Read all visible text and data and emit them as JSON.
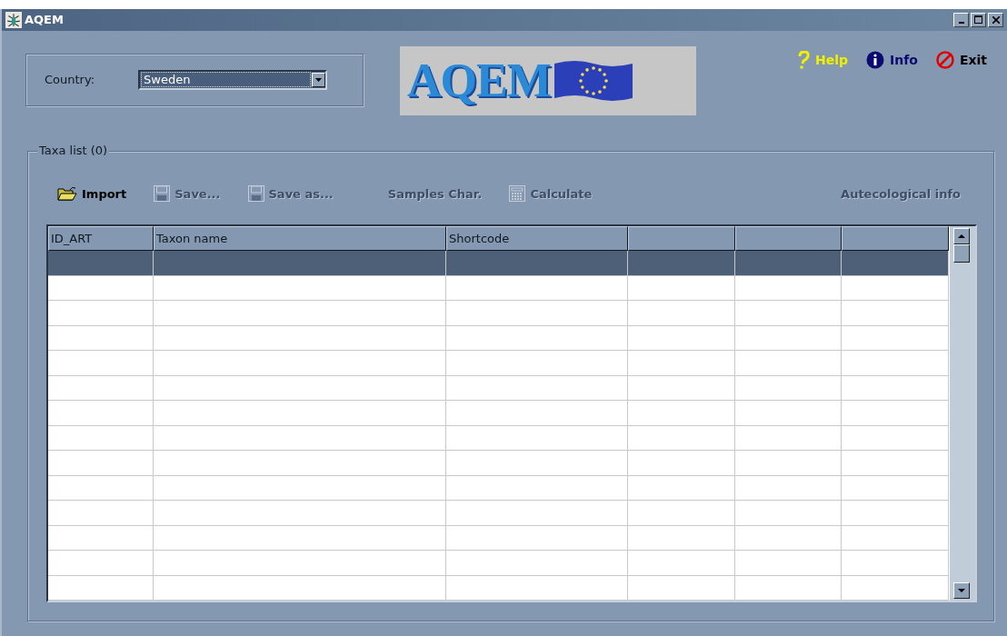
{
  "window": {
    "title": "AQEM"
  },
  "country": {
    "label": "Country:",
    "value": "Sweden"
  },
  "logo": {
    "text": "AQEM"
  },
  "top_actions": [
    {
      "kind": "help",
      "label": "Help"
    },
    {
      "kind": "info",
      "label": "Info"
    },
    {
      "kind": "exit",
      "label": "Exit"
    }
  ],
  "taxa_list": {
    "title": "Taxa list (0)",
    "toolbar": [
      {
        "kind": "import",
        "label": "Import",
        "disabled": false
      },
      {
        "kind": "save",
        "label": "Save...",
        "disabled": true
      },
      {
        "kind": "save",
        "label": "Save as...",
        "disabled": true
      },
      {
        "kind": "text",
        "label": "Samples Char.",
        "disabled": true
      },
      {
        "kind": "calc",
        "label": "Calculate",
        "disabled": true
      },
      {
        "kind": "spacer"
      },
      {
        "kind": "text",
        "label": "Autecological info",
        "disabled": true
      }
    ],
    "table": {
      "columns": [
        {
          "label": "ID_ART"
        },
        {
          "label": "Taxon name"
        },
        {
          "label": "Shortcode"
        },
        {},
        {},
        {}
      ],
      "rows": [
        {
          "selected": true
        },
        {
          "selected": false
        },
        {
          "selected": false
        },
        {
          "selected": false
        },
        {
          "selected": false
        },
        {
          "selected": false
        },
        {
          "selected": false
        },
        {
          "selected": false
        },
        {
          "selected": false
        },
        {
          "selected": false
        },
        {
          "selected": false
        },
        {
          "selected": false
        },
        {
          "selected": false
        },
        {
          "selected": false
        }
      ]
    }
  }
}
